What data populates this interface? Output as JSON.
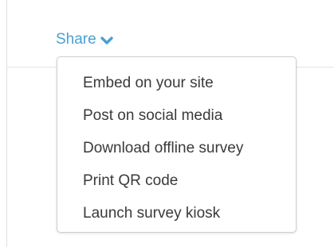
{
  "share": {
    "label": "Share",
    "icon": "chevron-down-icon",
    "color": "#4a9fd3"
  },
  "menu": {
    "items": [
      {
        "label": "Embed on your site"
      },
      {
        "label": "Post on social media"
      },
      {
        "label": "Download offline survey"
      },
      {
        "label": "Print QR code"
      },
      {
        "label": "Launch survey kiosk"
      }
    ]
  }
}
